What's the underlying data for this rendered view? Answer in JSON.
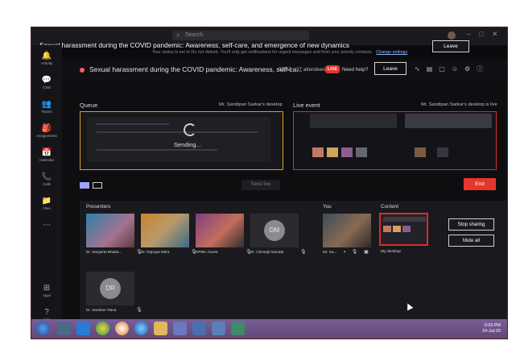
{
  "window": {
    "search_placeholder": "Search",
    "caption": "Sexual harassment during the COVID pandemic: Awareness, self-care, and emergence of new dynamics",
    "notice": "Your status is set to Do not disturb. You'll only get notifications for urgent messages and from your priority contacts.",
    "notice_link": "Change settings",
    "top_leave": "Leave"
  },
  "rail": [
    {
      "icon": "🔔",
      "label": "Activity"
    },
    {
      "icon": "💬",
      "label": "Chat"
    },
    {
      "icon": "👥",
      "label": "Teams"
    },
    {
      "icon": "🎒",
      "label": "Assignments"
    },
    {
      "icon": "📅",
      "label": "Calendar"
    },
    {
      "icon": "📞",
      "label": "Calls"
    },
    {
      "icon": "📁",
      "label": "Files"
    },
    {
      "icon": "⋯",
      "label": ""
    },
    {
      "icon": "⊞",
      "label": "Apps"
    },
    {
      "icon": "?",
      "label": "Help"
    }
  ],
  "meeting": {
    "title": "Sexual harassment during the COVID pandemic: Awareness, self-ca...",
    "time": "32:43",
    "attendees": "37 attendees",
    "live_badge": "LIVE",
    "help": "Need help?",
    "leave": "Leave"
  },
  "queue": {
    "heading": "Queue",
    "source": "Mr. Sandipan Sarkar's desktop",
    "status": "Sending..."
  },
  "live": {
    "heading": "Live event",
    "source": "Mr. Sandipan Sarkar's desktop is live"
  },
  "buttons": {
    "send_live": "Send live",
    "end": "End",
    "stop_sharing": "Stop sharing",
    "mute_all": "Mute all"
  },
  "presenters": {
    "heading": "Presenters",
    "items": [
      {
        "name": "Dr. Sanjukta Bhatta..."
      },
      {
        "name": "Dr. Rajrupa Mitra"
      },
      {
        "name": "RPMC Guest"
      },
      {
        "name": "Dr. Chiranjit Mondal",
        "initials": "DM"
      },
      {
        "name": "Dr. Sanbeer Rana",
        "initials": "DR"
      }
    ]
  },
  "you": {
    "heading": "You",
    "name": "Mr. Sa..."
  },
  "content": {
    "heading": "Content",
    "label": "My desktop"
  },
  "taskbar": {
    "time": "3:03 PM",
    "date": "24-Jul-20"
  }
}
